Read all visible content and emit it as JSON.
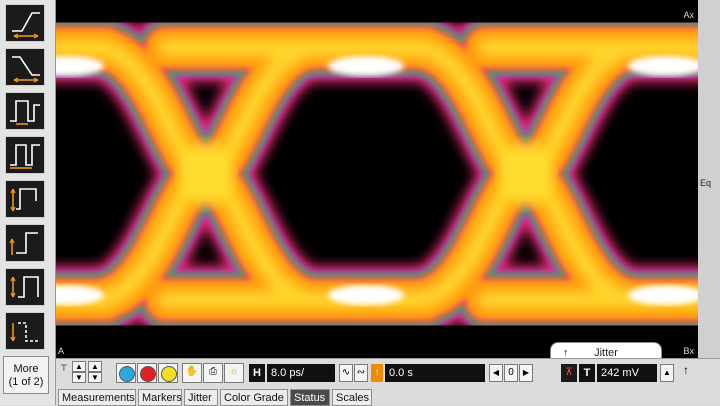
{
  "display": {
    "marker_top_right": "Ax",
    "marker_bottom_right": "Bx",
    "marker_bottom_left": "A",
    "marker_right_mid": "Eq"
  },
  "left_toolbar": {
    "tools": [
      {
        "name": "rising-edge-tool"
      },
      {
        "name": "falling-edge-tool"
      },
      {
        "name": "pulse-positive-tool"
      },
      {
        "name": "pulse-width-tool"
      },
      {
        "name": "period-tool"
      },
      {
        "name": "rise-time-tool"
      },
      {
        "name": "amplitude-tool"
      },
      {
        "name": "fall-time-tool"
      }
    ],
    "more_line1": "More",
    "more_line2": "(1 of 2)"
  },
  "bottom_bar": {
    "time_scale": "8.0 ps/",
    "time_position": "0.0 s",
    "time_position_stepper": "0",
    "trigger_level": "242 mV",
    "h_label": "H",
    "t_label": "T",
    "trigger_slope_glyph": "↑"
  },
  "jitter_tab": {
    "label": "Jitter"
  },
  "tabs": [
    "Measurements",
    "Markers",
    "Jitter",
    "Color Grade",
    "Status",
    "Scales"
  ],
  "active_tab": "Status",
  "colors": {
    "outer": "#ff2f7a",
    "band1": "#b43cc8",
    "band2": "#20c040",
    "band3": "#ff9a10",
    "core": "#ffe030",
    "hot": "#ffffff"
  }
}
